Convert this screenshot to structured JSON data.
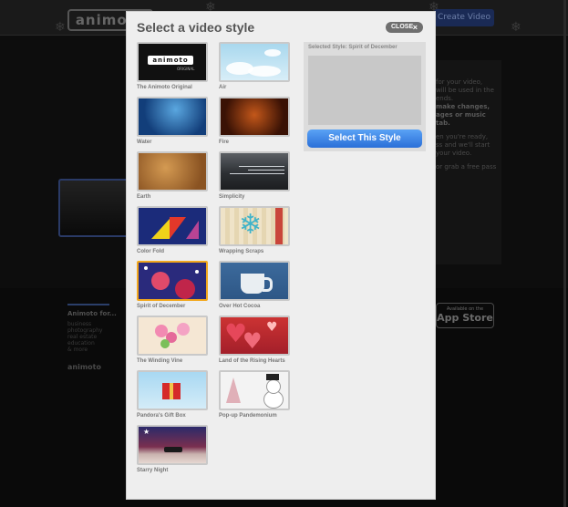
{
  "background_page": {
    "logo_text": "animoto",
    "create_video_label": "Create Video",
    "info_lines": [
      "for your video,",
      "will be used in the",
      "ends.",
      "make changes,",
      "ages or music tab.",
      "",
      "en you're ready,",
      "ss and we'll start",
      "your video.",
      "",
      "or grab a free pass"
    ],
    "footer_title": "Animoto for...",
    "footer_links": [
      "business",
      "photography",
      "real estate",
      "education",
      "& more"
    ],
    "footer_logo": "animoto",
    "app_store_small": "Available on the",
    "app_store_big": "App Store"
  },
  "modal": {
    "title": "Select a video style",
    "close_label": "CLOSE",
    "close_icon": "×",
    "selected_style_label": "Selected Style: Spirit of December",
    "select_button_label": "Select This Style",
    "accent_color": "#f2a81e",
    "button_color": "#3b86e6",
    "styles": [
      {
        "name": "The Animoto Original",
        "icon": "animoto-original-thumbnail",
        "thumb_text": "animoto",
        "thumb_subtext": "ORIGINAL"
      },
      {
        "name": "Air",
        "icon": "clouds-thumbnail"
      },
      {
        "name": "Water",
        "icon": "water-thumbnail"
      },
      {
        "name": "Fire",
        "icon": "fire-thumbnail"
      },
      {
        "name": "Earth",
        "icon": "earth-thumbnail"
      },
      {
        "name": "Simplicity",
        "icon": "simplicity-thumbnail"
      },
      {
        "name": "Color Fold",
        "icon": "color-fold-thumbnail"
      },
      {
        "name": "Wrapping Scraps",
        "icon": "snowflake-thumbnail"
      },
      {
        "name": "Spirit of December",
        "icon": "ornaments-thumbnail",
        "selected": true
      },
      {
        "name": "Over Hot Cocoa",
        "icon": "cocoa-cup-thumbnail"
      },
      {
        "name": "The Winding Vine",
        "icon": "vine-flowers-thumbnail"
      },
      {
        "name": "Land of the Rising Hearts",
        "icon": "hearts-thumbnail"
      },
      {
        "name": "Pandora's Gift Box",
        "icon": "gift-box-thumbnail"
      },
      {
        "name": "Pop-up Pandemonium",
        "icon": "snowman-thumbnail"
      },
      {
        "name": "Starry Night",
        "icon": "starry-night-thumbnail"
      }
    ]
  }
}
